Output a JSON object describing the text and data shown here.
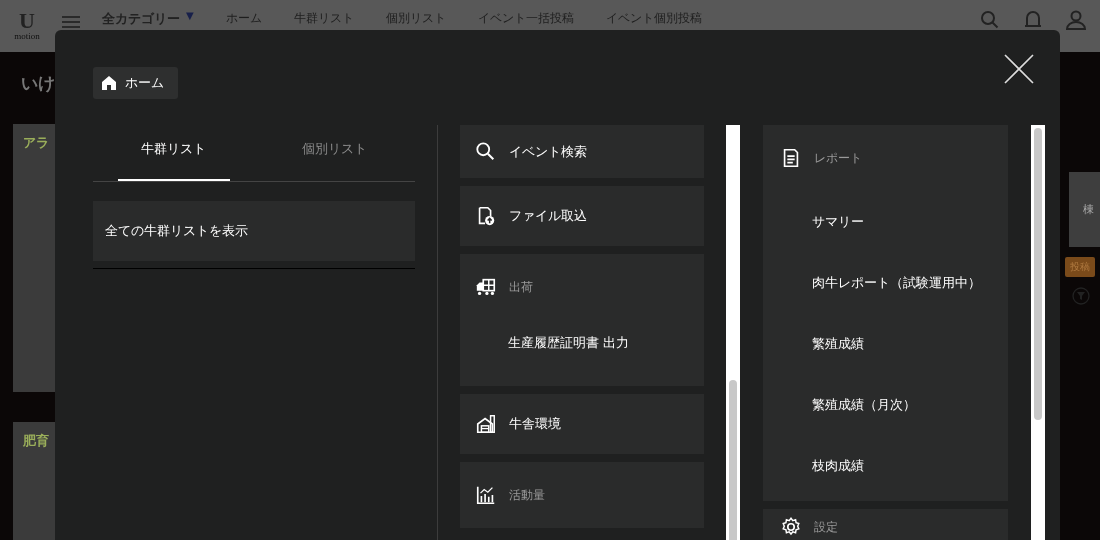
{
  "background": {
    "logo": {
      "letter": "U",
      "sub": "motion"
    },
    "category": "全カテゴリー",
    "category_caret": "▼",
    "nav": [
      "ホーム",
      "牛群リスト",
      "個別リスト",
      "イベント一括投稿",
      "イベント個別投稿"
    ],
    "farm_name": "いけ",
    "panels": [
      {
        "title": "アラ"
      },
      {
        "title": "肥育"
      }
    ],
    "unit": "棟",
    "post_button": "投稿"
  },
  "modal": {
    "home_button": "ホーム",
    "tabs": [
      {
        "label": "牛群リスト",
        "selected": true
      },
      {
        "label": "個別リスト",
        "selected": false
      }
    ],
    "list_items": [
      "全ての牛群リストを表示"
    ],
    "menu_columns": [
      [
        {
          "kind": "link",
          "label": "イベント検索"
        },
        {
          "kind": "link",
          "label": "ファイル取込"
        },
        {
          "kind": "group",
          "label": "出荷",
          "items": [
            "生産履歴証明書 出力"
          ]
        },
        {
          "kind": "link",
          "label": "牛舎環境"
        },
        {
          "kind": "group",
          "label": "活動量"
        }
      ],
      [
        {
          "kind": "group",
          "label": "レポート",
          "items": [
            "サマリー",
            "肉牛レポート（試験運用中）",
            "繁殖成績",
            "繁殖成績（月次）",
            "枝肉成績"
          ]
        },
        {
          "kind": "group",
          "label": "設定"
        }
      ]
    ]
  }
}
